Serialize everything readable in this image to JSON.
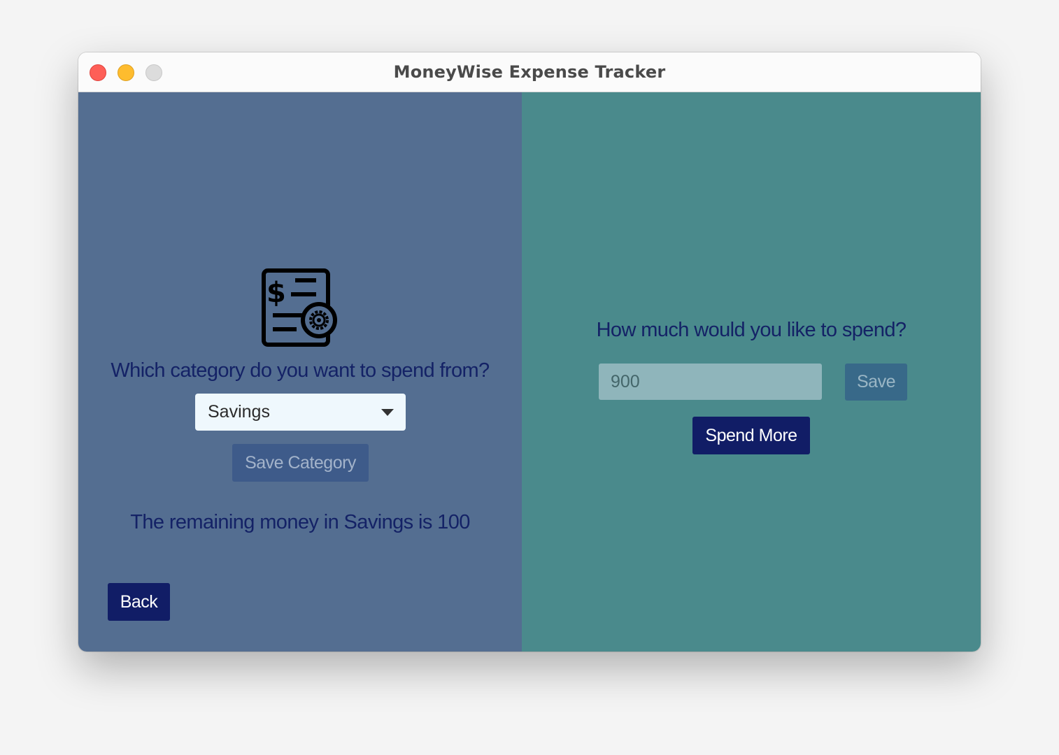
{
  "window": {
    "title": "MoneyWise Expense Tracker"
  },
  "left": {
    "icon": "bill-settings-icon",
    "question": "Which category do you want to spend from?",
    "category_select": {
      "selected": "Savings"
    },
    "save_category_label": "Save Category",
    "remaining_text": "The remaining money in Savings is 100",
    "back_label": "Back"
  },
  "right": {
    "question": "How much would you like to spend?",
    "amount_input": {
      "value": "900"
    },
    "save_label": "Save",
    "spend_more_label": "Spend More"
  },
  "colors": {
    "left_panel": "#546e91",
    "right_panel": "#4a8a8c",
    "primary_button": "#111d66",
    "heading_text": "#142266"
  }
}
